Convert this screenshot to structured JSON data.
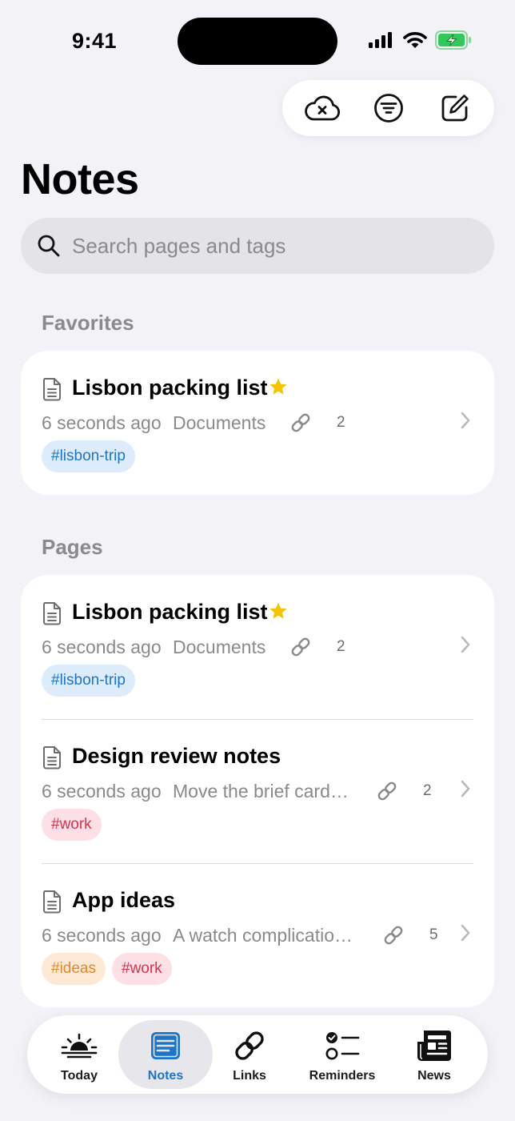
{
  "status_bar": {
    "time": "9:41"
  },
  "toolbar": {
    "icons": [
      "cloud-off-icon",
      "filter-icon",
      "compose-icon"
    ]
  },
  "page": {
    "title": "Notes"
  },
  "search": {
    "placeholder": "Search pages and tags",
    "value": ""
  },
  "sections": {
    "favorites": {
      "header": "Favorites",
      "items": [
        {
          "title": "Lisbon packing list",
          "favorite": true,
          "time": "6 seconds ago",
          "preview": "Documents",
          "links": "2",
          "tags": [
            {
              "label": "#lisbon-trip",
              "color": "#1d74c9"
            }
          ]
        }
      ]
    },
    "pages": {
      "header": "Pages",
      "items": [
        {
          "title": "Lisbon packing list",
          "favorite": true,
          "time": "6 seconds ago",
          "preview": "Documents",
          "links": "2",
          "tags": [
            {
              "label": "#lisbon-trip",
              "color": "#1d74c9"
            }
          ]
        },
        {
          "title": "Design review notes",
          "favorite": false,
          "time": "6 seconds ago",
          "preview": "Move the brief card…",
          "links": "2",
          "tags": [
            {
              "label": "#work",
              "color": "#d6334f"
            }
          ]
        },
        {
          "title": "App ideas",
          "favorite": false,
          "time": "6 seconds ago",
          "preview": "A watch complicatio…",
          "links": "5",
          "tags": [
            {
              "label": "#ideas",
              "color": "#e4892b"
            },
            {
              "label": "#work",
              "color": "#d6334f"
            }
          ]
        }
      ]
    }
  },
  "tabbar": {
    "tabs": [
      {
        "label": "Today",
        "icon": "sunrise-icon",
        "active": false
      },
      {
        "label": "Notes",
        "icon": "notes-icon",
        "active": true
      },
      {
        "label": "Links",
        "icon": "link-icon",
        "active": false
      },
      {
        "label": "Reminders",
        "icon": "checklist-icon",
        "active": false
      },
      {
        "label": "News",
        "icon": "newspaper-icon",
        "active": false
      }
    ]
  },
  "colors": {
    "accent": "#1d74c9",
    "star": "#f5c400",
    "background": "#f2f2f7",
    "battery": "#34c759"
  }
}
